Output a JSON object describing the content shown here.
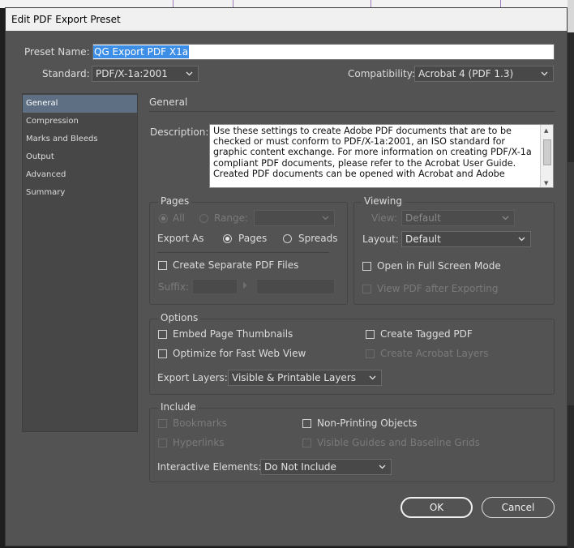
{
  "window": {
    "title": "Edit PDF Export Preset"
  },
  "preset": {
    "name_label": "Preset Name:",
    "name_value": "QG Export PDF X1a",
    "standard_label": "Standard:",
    "standard_value": "PDF/X-1a:2001",
    "compat_label": "Compatibility:",
    "compat_value": "Acrobat 4 (PDF 1.3)"
  },
  "sidebar": {
    "items": [
      {
        "label": "General",
        "active": true
      },
      {
        "label": "Compression"
      },
      {
        "label": "Marks and Bleeds"
      },
      {
        "label": "Output"
      },
      {
        "label": "Advanced"
      },
      {
        "label": "Summary"
      }
    ]
  },
  "general": {
    "title": "General",
    "description_label": "Description:",
    "description_text": "Use these settings to create Adobe PDF documents that are to be checked or must conform to PDF/X-1a:2001, an ISO standard for graphic content exchange.  For more information on creating PDF/X-1a compliant PDF documents, please refer to the Acrobat User Guide. Created PDF documents can be opened with Acrobat and Adobe"
  },
  "pages": {
    "title": "Pages",
    "all_label": "All",
    "range_label": "Range:",
    "export_as_label": "Export As",
    "pages_label": "Pages",
    "spreads_label": "Spreads",
    "separate_files_label": "Create Separate PDF Files",
    "suffix_label": "Suffix:"
  },
  "viewing": {
    "title": "Viewing",
    "view_label": "View:",
    "view_value": "Default",
    "layout_label": "Layout:",
    "layout_value": "Default",
    "fullscreen_label": "Open in Full Screen Mode",
    "view_after_label": "View PDF after Exporting"
  },
  "options": {
    "title": "Options",
    "embed_thumbs_label": "Embed Page Thumbnails",
    "optimize_web_label": "Optimize for Fast Web View",
    "tagged_pdf_label": "Create Tagged PDF",
    "acrobat_layers_label": "Create Acrobat Layers",
    "export_layers_label": "Export Layers:",
    "export_layers_value": "Visible & Printable Layers"
  },
  "include": {
    "title": "Include",
    "bookmarks_label": "Bookmarks",
    "hyperlinks_label": "Hyperlinks",
    "non_printing_label": "Non-Printing Objects",
    "guides_label": "Visible Guides and Baseline Grids",
    "interactive_label": "Interactive Elements:",
    "interactive_value": "Do Not Include"
  },
  "buttons": {
    "ok": "OK",
    "cancel": "Cancel"
  },
  "colors": {
    "dialog_bg": "#535353",
    "sidebar_active": "#5e6f83",
    "selection": "#3d8ee6"
  }
}
